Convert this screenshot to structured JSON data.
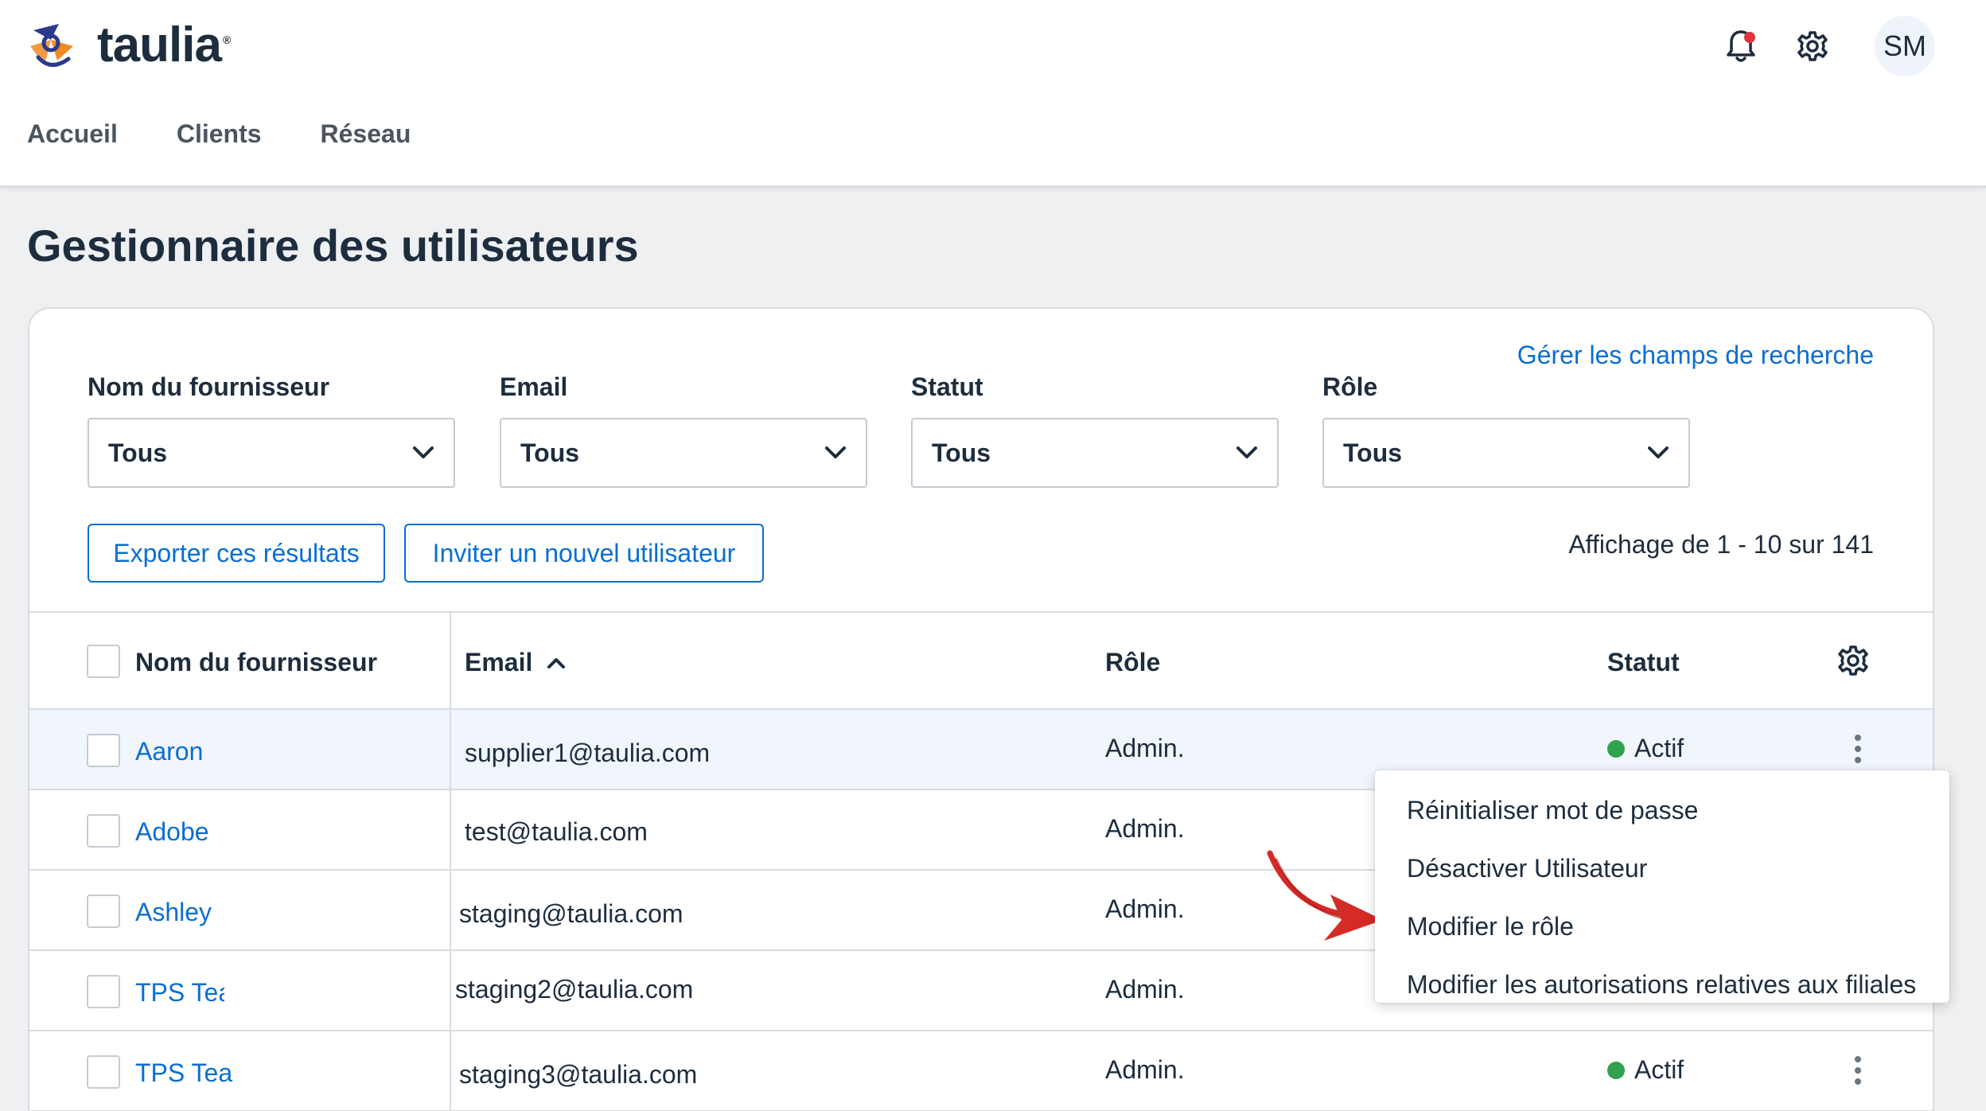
{
  "header": {
    "logo_text": "taulia",
    "logo_reg": "®",
    "avatar_initials": "SM",
    "icons": [
      "bell-icon",
      "gear-icon"
    ],
    "notification_color": "#e0343a"
  },
  "nav": {
    "items": [
      "Accueil",
      "Clients",
      "Réseau"
    ]
  },
  "page": {
    "title": "Gestionnaire des utilisateurs"
  },
  "filters": {
    "manage_link": "Gérer les champs de recherche",
    "items": [
      {
        "label": "Nom du fournisseur",
        "value": "Tous"
      },
      {
        "label": "Email",
        "value": "Tous"
      },
      {
        "label": "Statut",
        "value": "Tous"
      },
      {
        "label": "Rôle",
        "value": "Tous"
      }
    ]
  },
  "actions": {
    "export_label": "Exporter ces résultats",
    "invite_label": "Inviter un nouvel utilisateur",
    "results_count": "Affichage de 1 - 10 sur 141"
  },
  "table": {
    "columns": {
      "name": "Nom du fournisseur",
      "email": "Email",
      "role": "Rôle",
      "status": "Statut"
    },
    "rows": [
      {
        "name": "Aaron",
        "email": "supplier1@taulia.com",
        "role": "Admin.",
        "status": "Actif"
      },
      {
        "name": "Adobe",
        "email": "test@taulia.com",
        "role": "Admin.",
        "status": ""
      },
      {
        "name": "Ashley",
        "email": "staging@taulia.com",
        "role": "Admin.",
        "status": ""
      },
      {
        "name": "TPS Tea",
        "email": "staging2@taulia.com",
        "role": "Admin.",
        "status": ""
      },
      {
        "name": "TPS Tear",
        "email": "staging3@taulia.com",
        "role": "Admin.",
        "status": "Actif"
      }
    ],
    "status_color": "#30a14e"
  },
  "context_menu": {
    "items": [
      "Réinitialiser mot de passe",
      "Désactiver Utilisateur",
      "Modifier le rôle",
      "Modifier les autorisations relatives aux filiales"
    ]
  },
  "colors": {
    "accent": "#0a6ed1",
    "annotation_arrow": "#d42b27"
  }
}
